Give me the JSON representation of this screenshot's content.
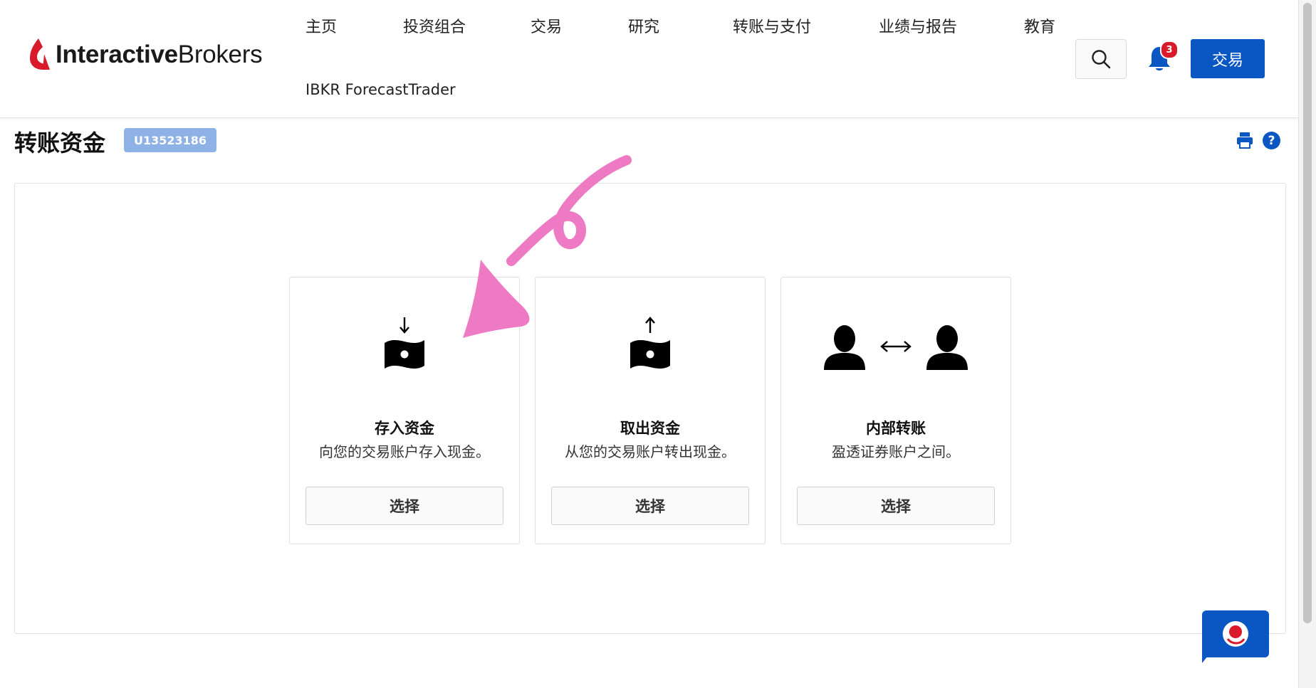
{
  "brand": {
    "logo_bold": "Interactive",
    "logo_light": "Brokers"
  },
  "nav": {
    "items": [
      "主页",
      "投资组合",
      "交易",
      "研究",
      "转账与支付",
      "业绩与报告",
      "教育"
    ],
    "second_row": "IBKR ForecastTrader"
  },
  "header": {
    "notification_count": "3",
    "trade_button": "交易",
    "icons": {
      "search": "search-icon",
      "notifications": "bell-icon"
    }
  },
  "page": {
    "title": "转账资金",
    "account_id": "U13523186",
    "icons": {
      "print": "print-icon",
      "help": "help-icon"
    }
  },
  "cards": [
    {
      "title": "存入资金",
      "description": "向您的交易账户存入现金。",
      "button": "选择",
      "icon": "deposit-cash-icon"
    },
    {
      "title": "取出资金",
      "description": "从您的交易账户转出现金。",
      "button": "选择",
      "icon": "withdraw-cash-icon"
    },
    {
      "title": "内部转账",
      "description": "盈透证券账户之间。",
      "button": "选择",
      "icon": "internal-transfer-icon"
    }
  ],
  "annotation": {
    "color": "#ee7ac4",
    "icon": "annotation-arrow-icon"
  },
  "colors": {
    "accent": "#0a57c4",
    "badge": "#8fb2e6",
    "notification": "#d81a2a",
    "logo_red": "#d81a2a"
  },
  "chat": {
    "icon": "chat-icon"
  }
}
